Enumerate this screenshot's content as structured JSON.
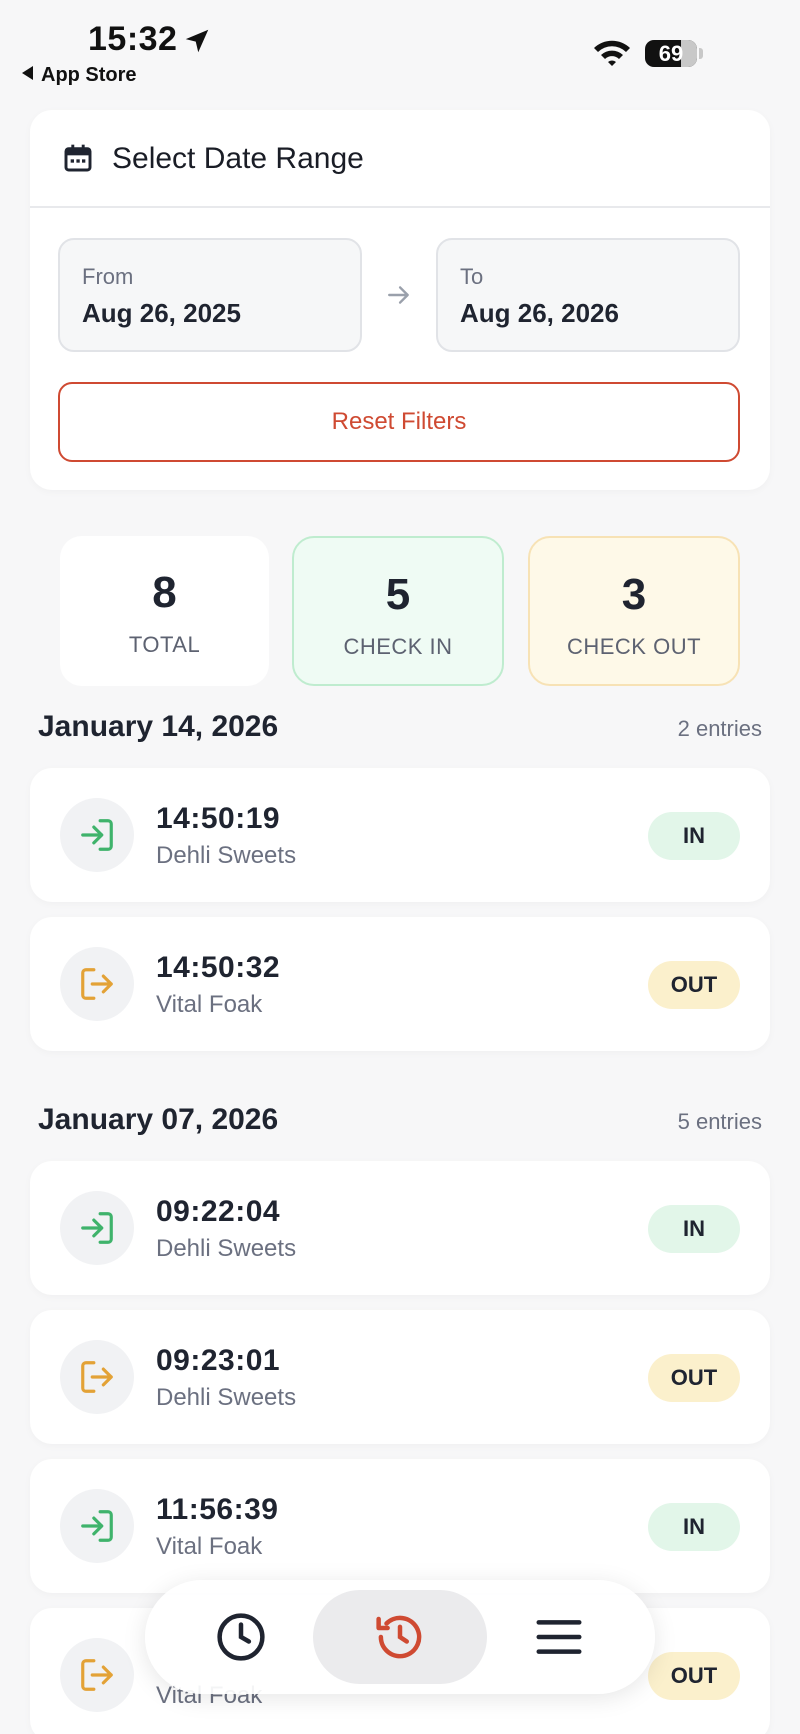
{
  "status_bar": {
    "time": "15:32",
    "back_app": "App Store",
    "battery": "69"
  },
  "date_range": {
    "title": "Select Date Range",
    "from_label": "From",
    "from_value": "Aug 26, 2025",
    "to_label": "To",
    "to_value": "Aug 26, 2026",
    "reset_label": "Reset Filters"
  },
  "stats": {
    "total": {
      "value": "8",
      "label": "TOTAL"
    },
    "check_in": {
      "value": "5",
      "label": "CHECK IN"
    },
    "check_out": {
      "value": "3",
      "label": "CHECK OUT"
    }
  },
  "groups": [
    {
      "date": "January 14, 2026",
      "count": "2 entries",
      "entries": [
        {
          "time": "14:50:19",
          "place": "Dehli Sweets",
          "status": "IN"
        },
        {
          "time": "14:50:32",
          "place": "Vital Foak",
          "status": "OUT"
        }
      ]
    },
    {
      "date": "January 07, 2026",
      "count": "5 entries",
      "entries": [
        {
          "time": "09:22:04",
          "place": "Dehli Sweets",
          "status": "IN"
        },
        {
          "time": "09:23:01",
          "place": "Dehli Sweets",
          "status": "OUT"
        },
        {
          "time": "11:56:39",
          "place": "Vital Foak",
          "status": "IN"
        },
        {
          "time": "",
          "place": "Vital Foak",
          "status": "OUT"
        }
      ]
    }
  ],
  "tabbar": {
    "items": [
      {
        "icon": "clock-icon"
      },
      {
        "icon": "history-icon",
        "active": true
      },
      {
        "icon": "menu-icon"
      }
    ]
  },
  "colors": {
    "accent": "#cf4a32",
    "check_in": "#3fb36b",
    "check_out": "#e3a236"
  }
}
